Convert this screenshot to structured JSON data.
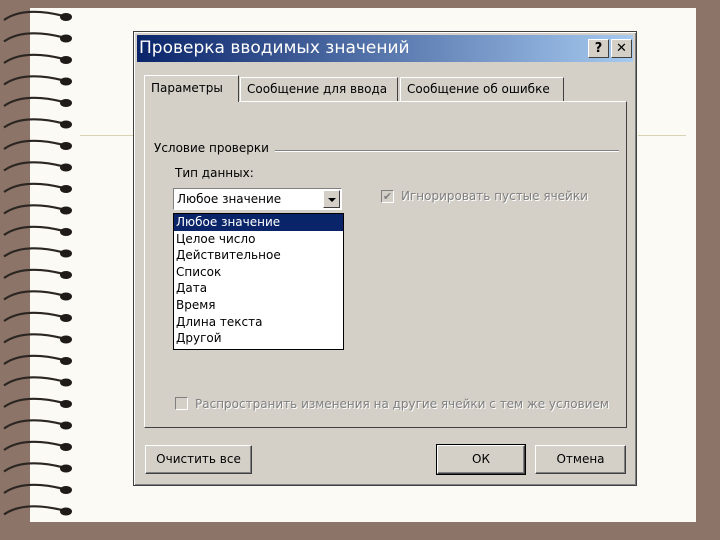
{
  "dialog": {
    "title": "Проверка вводимых значений",
    "help_button": "?",
    "close_button": "✕"
  },
  "tabs": [
    {
      "label": "Параметры",
      "active": true
    },
    {
      "label": "Сообщение для ввода",
      "active": false
    },
    {
      "label": "Сообщение об ошибке",
      "active": false
    }
  ],
  "settings": {
    "group_label": "Условие проверки",
    "data_type_label": "Тип данных:",
    "data_type_value": "Любое значение",
    "data_type_options": [
      "Любое значение",
      "Целое число",
      "Действительное",
      "Список",
      "Дата",
      "Время",
      "Длина текста",
      "Другой"
    ],
    "ignore_blank_label": "Игнорировать пустые ячейки",
    "ignore_blank_checked": true,
    "apply_all_label": "Распространить изменения на другие ячейки с тем же условием",
    "apply_all_checked": false
  },
  "buttons": {
    "clear_all": "Очистить все",
    "ok": "ОК",
    "cancel": "Отмена"
  },
  "colors": {
    "background": "#8c7468",
    "page": "#fbfaf5",
    "dialog_face": "#d4d0c8",
    "titlebar_start": "#0a246a",
    "titlebar_end": "#a6caf0",
    "selection": "#0a246a"
  }
}
